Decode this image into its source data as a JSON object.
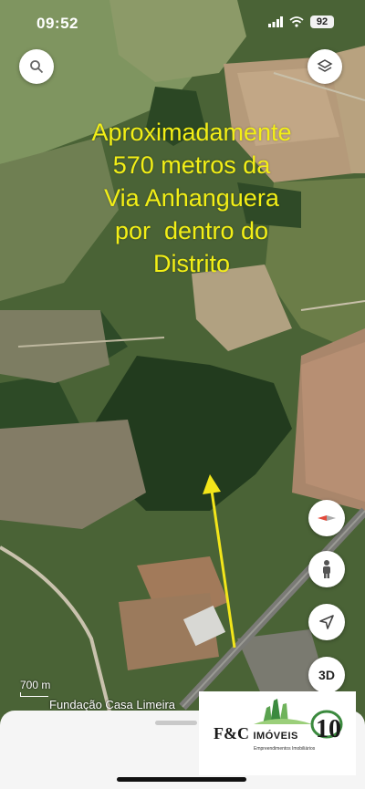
{
  "status_bar": {
    "time": "09:52",
    "battery": "92"
  },
  "map": {
    "overlay_lines": [
      "Aproximadamente",
      "570 metros da",
      "Via Anhanguera",
      "por  dentro do",
      "Distrito"
    ],
    "scale_label": "700 m",
    "poi_label": "Fundação Casa Limeira",
    "controls": {
      "three_d_label": "3D"
    }
  },
  "logo": {
    "brand": "F&C",
    "brand_suffix": "IMÓVEIS",
    "badge": "10",
    "tagline": "Empreendimentos Imobiliários"
  },
  "colors": {
    "overlay_text": "#f3ef16",
    "arrow": "#f3e61a",
    "compass_red": "#e24a3b"
  },
  "icons": [
    "search-icon",
    "layers-icon",
    "wifi-icon",
    "signal-icon",
    "battery-icon",
    "compass-icon",
    "pegman-icon",
    "location-arrow-icon"
  ]
}
